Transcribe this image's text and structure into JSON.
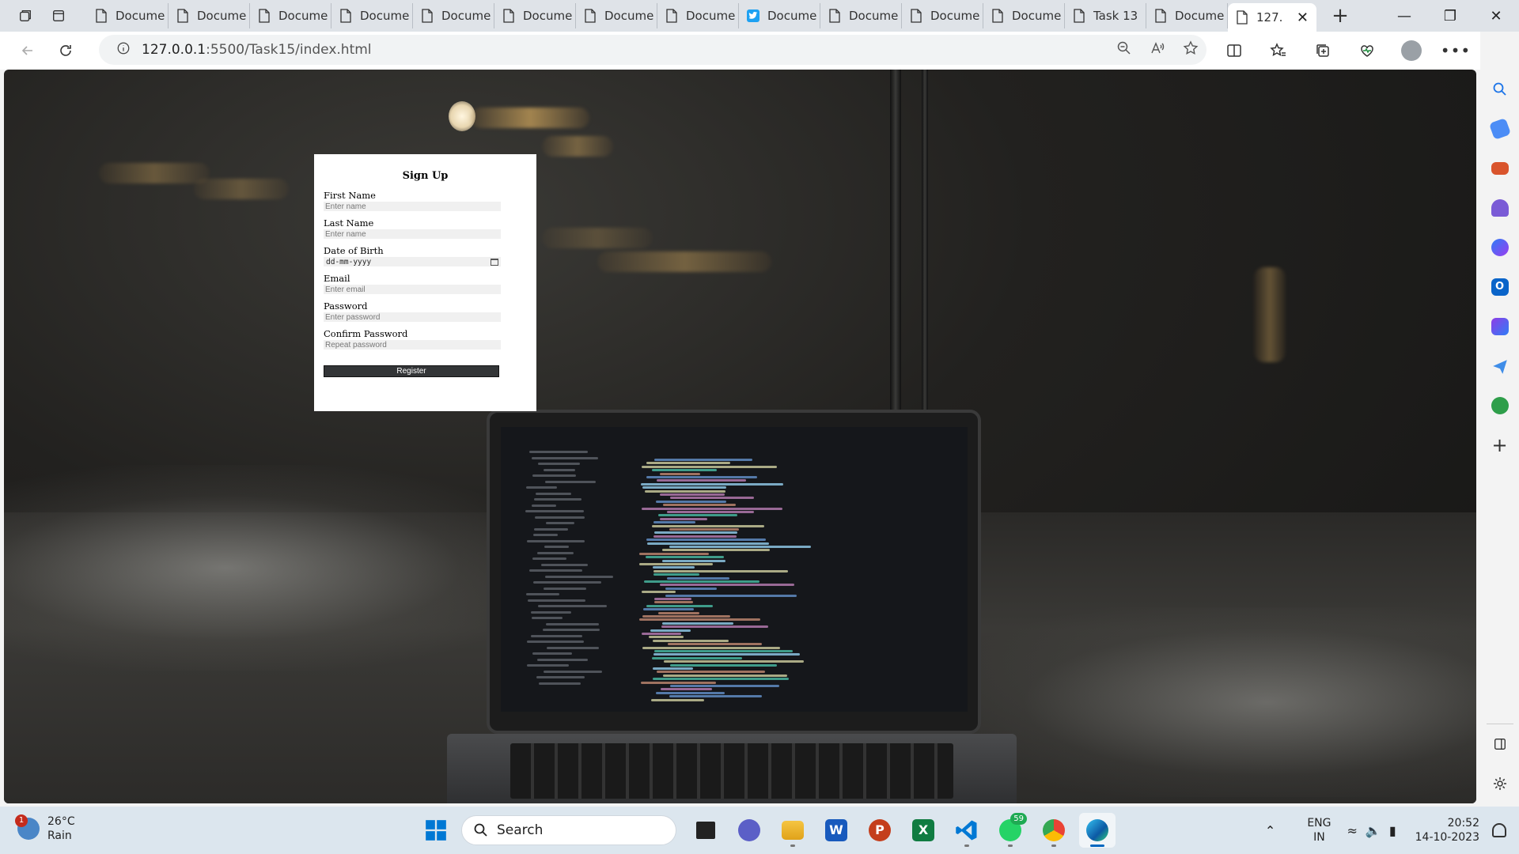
{
  "browser": {
    "tabs": [
      {
        "label": "Docume",
        "icon": "document-icon"
      },
      {
        "label": "Docume",
        "icon": "document-icon"
      },
      {
        "label": "Docume",
        "icon": "document-icon"
      },
      {
        "label": "Docume",
        "icon": "document-icon"
      },
      {
        "label": "Docume",
        "icon": "document-icon"
      },
      {
        "label": "Docume",
        "icon": "document-icon"
      },
      {
        "label": "Docume",
        "icon": "document-icon"
      },
      {
        "label": "Docume",
        "icon": "document-icon"
      },
      {
        "label": "Docume",
        "icon": "twitter-icon"
      },
      {
        "label": "Docume",
        "icon": "document-icon"
      },
      {
        "label": "Docume",
        "icon": "document-icon"
      },
      {
        "label": "Docume",
        "icon": "document-icon"
      },
      {
        "label": "Task 13",
        "icon": "document-icon"
      },
      {
        "label": "Docume",
        "icon": "document-icon"
      }
    ],
    "active_tab": {
      "label": "127.",
      "icon": "document-icon"
    },
    "url_host": "127.0.0.1",
    "url_rest": ":5500/Task15/index.html"
  },
  "form": {
    "title": "Sign Up",
    "first_name": {
      "label": "First Name",
      "placeholder": "Enter name"
    },
    "last_name": {
      "label": "Last Name",
      "placeholder": "Enter name"
    },
    "dob": {
      "label": "Date of Birth",
      "placeholder": "dd-mm-yyyy"
    },
    "email": {
      "label": "Email",
      "placeholder": "Enter email"
    },
    "password": {
      "label": "Password",
      "placeholder": "Enter password"
    },
    "confirm_password": {
      "label": "Confirm Password",
      "placeholder": "Repeat password"
    },
    "submit_label": "Register"
  },
  "taskbar": {
    "weather_temp": "26°C",
    "weather_desc": "Rain",
    "weather_badge": "1",
    "search_label": "Search",
    "whatsapp_badge": "59",
    "lang_line1": "ENG",
    "lang_line2": "IN",
    "time": "20:52",
    "date": "14-10-2023"
  },
  "colors": {
    "accent": "#0067c0",
    "register_button": "#333537",
    "taskbar": "#dce6ee"
  }
}
